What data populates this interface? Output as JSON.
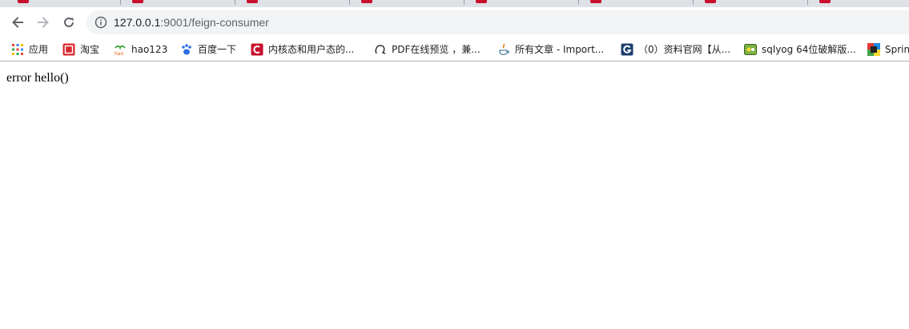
{
  "toolbar": {
    "back_icon": "arrow-left-icon",
    "forward_icon": "arrow-right-icon",
    "reload_icon": "reload-icon",
    "address": {
      "info_icon": "info-circle-icon",
      "host": "127.0.0.1",
      "rest": ":9001/feign-consumer"
    }
  },
  "bookmarks": [
    {
      "label": "应用",
      "icon": "apps-grid-icon"
    },
    {
      "label": "淘宝",
      "icon": "taobao-icon"
    },
    {
      "label": "hao123",
      "icon": "hao123-icon"
    },
    {
      "label": "百度一下",
      "icon": "baidu-paw-icon"
    },
    {
      "label": "内核态和用户态的...",
      "icon": "csdn-icon"
    },
    {
      "label": "PDF在线预览 ，兼...",
      "icon": "omega-icon"
    },
    {
      "label": "所有文章 - Import...",
      "icon": "java-icon"
    },
    {
      "label": "（0）资料官网【从...",
      "icon": "g-logo-icon"
    },
    {
      "label": "sqlyog 64位破解版...",
      "icon": "sqlyog-icon"
    },
    {
      "label": "Sprin",
      "icon": "spring-icon"
    }
  ],
  "content": {
    "message": "error hello()"
  },
  "colors": {
    "tabstrip": "#dee1e6",
    "omnibox": "#f1f3f4",
    "csdn_red": "#c8102e"
  }
}
